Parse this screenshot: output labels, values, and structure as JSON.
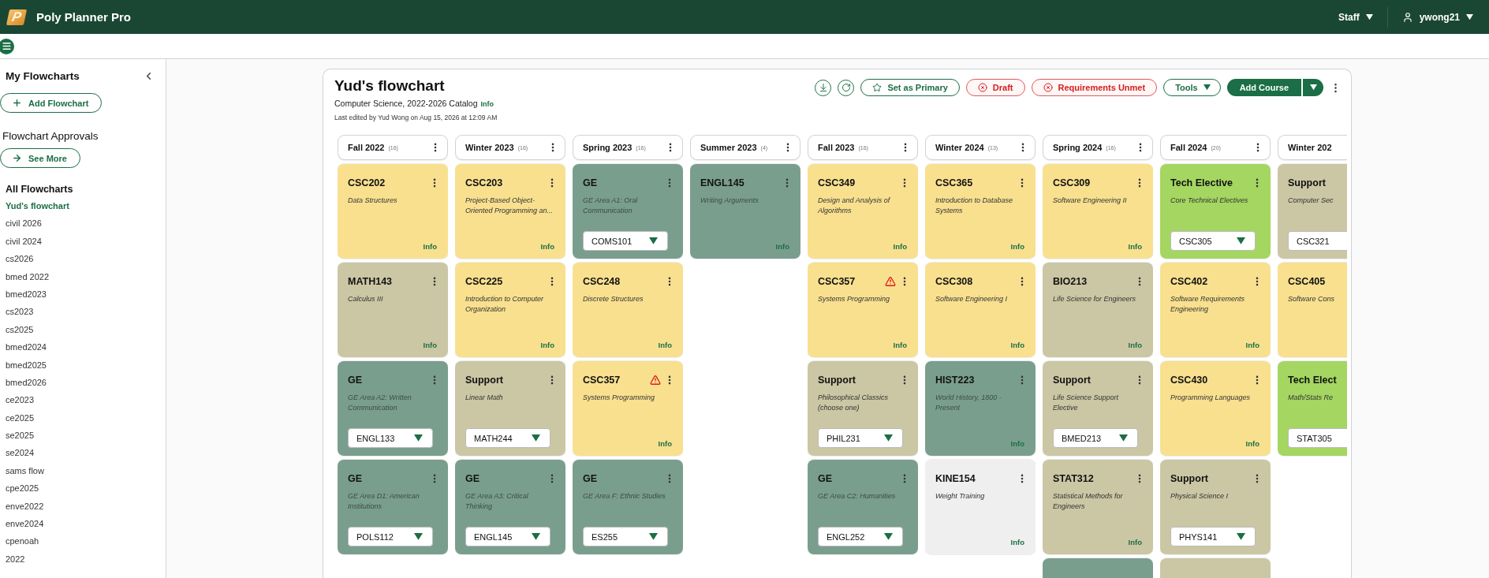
{
  "app": {
    "logo_letter": "P",
    "title": "Poly Planner Pro",
    "role_menu": "Staff",
    "user_menu": "ywong21"
  },
  "sidebar": {
    "heading": "My Flowcharts",
    "add_button": "Add Flowchart",
    "approvals_heading": "Flowchart Approvals",
    "see_more_button": "See More",
    "list_heading": "All Flowcharts",
    "items": [
      {
        "label": "Yud's flowchart",
        "selected": true
      },
      {
        "label": "civil 2026",
        "selected": false
      },
      {
        "label": "civil 2024",
        "selected": false
      },
      {
        "label": "cs2026",
        "selected": false
      },
      {
        "label": "bmed 2022",
        "selected": false
      },
      {
        "label": "bmed2023",
        "selected": false
      },
      {
        "label": "cs2023",
        "selected": false
      },
      {
        "label": "cs2025",
        "selected": false
      },
      {
        "label": "bmed2024",
        "selected": false
      },
      {
        "label": "bmed2025",
        "selected": false
      },
      {
        "label": "bmed2026",
        "selected": false
      },
      {
        "label": "ce2023",
        "selected": false
      },
      {
        "label": "ce2025",
        "selected": false
      },
      {
        "label": "se2025",
        "selected": false
      },
      {
        "label": "se2024",
        "selected": false
      },
      {
        "label": "sams flow",
        "selected": false
      },
      {
        "label": "cpe2025",
        "selected": false
      },
      {
        "label": "enve2022",
        "selected": false
      },
      {
        "label": "enve2024",
        "selected": false
      },
      {
        "label": "cpenoah",
        "selected": false
      },
      {
        "label": "2022",
        "selected": false
      }
    ]
  },
  "flowchart": {
    "title": "Yud's flowchart",
    "catalog": "Computer Science, 2022-2026 Catalog",
    "catalog_link": "Info",
    "last_edited": "Last edited by Yud Wong on Aug 15, 2026 at 12:09 AM",
    "toolbar": [
      {
        "kind": "download"
      },
      {
        "kind": "refresh"
      },
      {
        "kind": "primary",
        "label": "Set as Primary"
      },
      {
        "kind": "status",
        "label": "Draft"
      },
      {
        "kind": "status",
        "label": "Requirements Unmet"
      },
      {
        "kind": "menu",
        "label": "Tools"
      },
      {
        "kind": "split",
        "label": "Add Course"
      },
      {
        "kind": "more"
      }
    ],
    "terms": [
      {
        "name": "Fall 2022",
        "count": "(16)",
        "partial": false,
        "courses": [
          {
            "kind": "major",
            "code": "CSC202",
            "title": "Data Structures",
            "link": "Info",
            "warning": false
          },
          {
            "kind": "support",
            "code": "MATH143",
            "title": "Calculus III",
            "link": "Info",
            "warning": false
          },
          {
            "kind": "ge",
            "code": "GE",
            "title": "GE Area A2: Written Communication",
            "choice": "ENGL133",
            "warning": false
          },
          {
            "kind": "ge",
            "code": "GE",
            "title": "GE Area D1: American Institutions",
            "choice": "POLS112",
            "warning": false
          }
        ]
      },
      {
        "name": "Winter 2023",
        "count": "(16)",
        "partial": false,
        "courses": [
          {
            "kind": "major",
            "code": "CSC203",
            "title": "Project-Based Object-Oriented Programming an...",
            "link": "Info",
            "warning": false
          },
          {
            "kind": "major",
            "code": "CSC225",
            "title": "Introduction to Computer Organization",
            "link": "Info",
            "warning": false
          },
          {
            "kind": "support",
            "code": "Support",
            "title": "Linear Math",
            "choice": "MATH244",
            "warning": false
          },
          {
            "kind": "ge",
            "code": "GE",
            "title": "GE Area A3: Critical Thinking",
            "choice": "ENGL145",
            "warning": false
          }
        ]
      },
      {
        "name": "Spring 2023",
        "count": "(16)",
        "partial": false,
        "courses": [
          {
            "kind": "ge",
            "code": "GE",
            "title": "GE Area A1: Oral Communication",
            "choice": "COMS101",
            "warning": false
          },
          {
            "kind": "major",
            "code": "CSC248",
            "title": "Discrete Structures",
            "link": "Info",
            "warning": false
          },
          {
            "kind": "major",
            "code": "CSC357",
            "title": "Systems Programming",
            "link": "Info",
            "warning": true
          },
          {
            "kind": "ge",
            "code": "GE",
            "title": "GE Area F: Ethnic Studies",
            "choice": "ES255",
            "warning": false
          }
        ]
      },
      {
        "name": "Summer 2023",
        "count": "(4)",
        "partial": false,
        "courses": [
          {
            "kind": "ge",
            "code": "ENGL145",
            "title": "Writing Arguments",
            "link": "Info",
            "warning": false
          }
        ]
      },
      {
        "name": "Fall 2023",
        "count": "(16)",
        "partial": false,
        "courses": [
          {
            "kind": "major",
            "code": "CSC349",
            "title": "Design and Analysis of Algorithms",
            "link": "Info",
            "warning": false
          },
          {
            "kind": "major",
            "code": "CSC357",
            "title": "Systems Programming",
            "link": "Info",
            "warning": true
          },
          {
            "kind": "support",
            "code": "Support",
            "title": "Philosophical Classics (choose one)",
            "choice": "PHIL231",
            "warning": false
          },
          {
            "kind": "ge",
            "code": "GE",
            "title": "GE Area C2: Humanities",
            "choice": "ENGL252",
            "warning": false
          }
        ]
      },
      {
        "name": "Winter 2024",
        "count": "(13)",
        "partial": false,
        "courses": [
          {
            "kind": "major",
            "code": "CSC365",
            "title": "Introduction to Database Systems",
            "link": "Info",
            "warning": false
          },
          {
            "kind": "major",
            "code": "CSC308",
            "title": "Software Engineering I",
            "link": "Info",
            "warning": false
          },
          {
            "kind": "ge",
            "code": "HIST223",
            "title": "World History, 1800 - Present",
            "link": "Info",
            "warning": false
          },
          {
            "kind": "other",
            "code": "KINE154",
            "title": "Weight Training",
            "link": "Info",
            "warning": false
          }
        ]
      },
      {
        "name": "Spring 2024",
        "count": "(16)",
        "partial": false,
        "courses": [
          {
            "kind": "major",
            "code": "CSC309",
            "title": "Software Engineering II",
            "link": "Info",
            "warning": false
          },
          {
            "kind": "support",
            "code": "BIO213",
            "title": "Life Science for Engineers",
            "link": "Info",
            "warning": false
          },
          {
            "kind": "support",
            "code": "Support",
            "title": "Life Science Support Elective",
            "choice": "BMED213",
            "warning": false
          },
          {
            "kind": "support",
            "code": "STAT312",
            "title": "Statistical Methods for Engineers",
            "link": "Info",
            "warning": false
          },
          {
            "kind": "ge"
          }
        ]
      },
      {
        "name": "Fall 2024",
        "count": "(20)",
        "partial": false,
        "courses": [
          {
            "kind": "elective",
            "code": "Tech Elective",
            "title": "Core Technical Electives",
            "choice": "CSC305",
            "warning": false
          },
          {
            "kind": "major",
            "code": "CSC402",
            "title": "Software Requirements Engineering",
            "link": "Info",
            "warning": false
          },
          {
            "kind": "major",
            "code": "CSC430",
            "title": "Programming Languages",
            "link": "Info",
            "warning": false
          },
          {
            "kind": "support",
            "code": "Support",
            "title": "Physical Science I",
            "choice": "PHYS141",
            "warning": false
          },
          {
            "kind": "support"
          }
        ]
      },
      {
        "name": "Winter 202",
        "partial": true,
        "courses": [
          {
            "kind": "support",
            "code": "Support",
            "title": "Computer Sec",
            "choice": "CSC321",
            "warning": false
          },
          {
            "kind": "major",
            "code": "CSC405",
            "title": "Software Cons",
            "warning": false
          },
          {
            "kind": "elective",
            "code": "Tech Elect",
            "title": "Math/Stats Re",
            "choice": "STAT305",
            "warning": false
          }
        ]
      }
    ]
  }
}
